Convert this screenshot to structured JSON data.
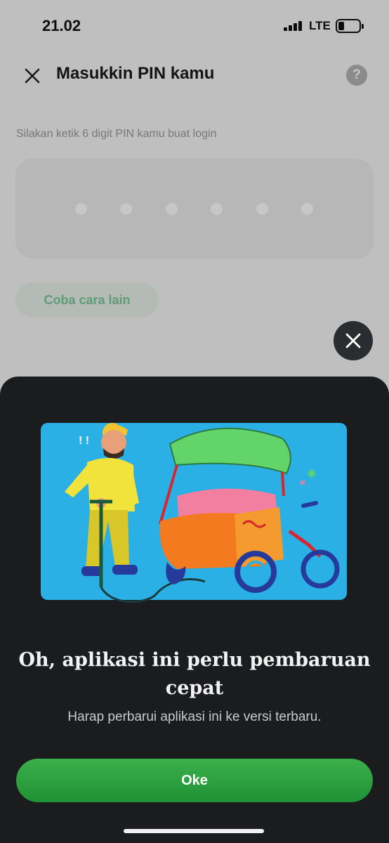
{
  "status": {
    "time": "21.02",
    "network": "LTE"
  },
  "header": {
    "title": "Masukkin PIN kamu",
    "help_label": "?"
  },
  "login": {
    "instruction": "Silakan ketik 6 digit PIN kamu buat login",
    "pin_length": 6,
    "alt_button": "Coba cara lain"
  },
  "sheet": {
    "title": "Oh, aplikasi ini perlu pembaruan cepat",
    "subtitle": "Harap perbarui aplikasi ini ke versi terbaru.",
    "ok_button": "Oke"
  },
  "colors": {
    "accent_green": "#1f9136",
    "sheet_bg": "#1b1c1e",
    "illustration_bg": "#2bb0e6"
  }
}
